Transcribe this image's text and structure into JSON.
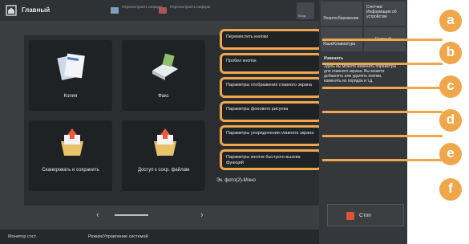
{
  "header": {
    "title": "Главный",
    "info1": "Перенастроить\nинформ.",
    "info2": "Перенастроить\nинформ.",
    "badge_label": "Вход"
  },
  "tiles": [
    {
      "label": "Копия",
      "icon": "copy-icon"
    },
    {
      "label": "Факс",
      "icon": "fax-icon"
    },
    {
      "label": "Сканировать\nи сохранить",
      "icon": "scan-save-icon"
    },
    {
      "label": "Доступ к сохр.\nфайлам",
      "icon": "stored-files-icon"
    }
  ],
  "menu": [
    "Переместить кнопки",
    "Пробел кнопок",
    "Параметры отображения главного экрана",
    "Параметры фонового рисунка",
    "Параметры упорядочения главного экрана",
    "Параметры кнопок быстрого вызова функций"
  ],
  "eco_label": "Эк. фото(2)-Моно",
  "right_panel": {
    "sleep_label": "Энергосбережение",
    "counter_label": "Счетчик/Информация об устройстве",
    "language_label": "Язык/Клавиатура",
    "home_label": "Главный",
    "settings_title": "Изменить",
    "description": "Здесь вы можете изменить параметры для главного экрана. Вы можете добавлять или удалять кнопки, изменять их порядок и т.д."
  },
  "stop_label": "Стоп",
  "bottom": {
    "status_monitor": "Монитор сост.",
    "toolbar": "Режим/Управление системой"
  },
  "callouts": [
    "a",
    "b",
    "c",
    "d",
    "e",
    "f"
  ],
  "colors": {
    "accent": "#f0a64b",
    "stop": "#e2503b"
  }
}
